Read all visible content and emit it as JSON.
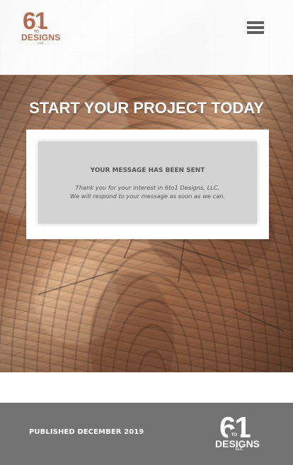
{
  "header": {
    "logo": {
      "number": "61",
      "to": "TO",
      "designs": "DESIGNS",
      "llc": "LLC"
    },
    "menu_icon": "hamburger-menu-icon"
  },
  "hero": {
    "title": "START YOUR PROJECT TODAY",
    "message": {
      "title": "YOUR MESSAGE HAS BEEN SENT",
      "line1": "Thank you for your interest in 6to1 Designs, LLC.",
      "line2": "We will respond to your message as soon as we can."
    }
  },
  "footer": {
    "published": "PUBLISHED DECEMBER 2019",
    "logo": {
      "number": "61",
      "to": "TO",
      "designs": "DESIGNS",
      "llc": "LLC"
    }
  },
  "colors": {
    "logo_brown": "#b06d51",
    "footer_gray": "#737373",
    "message_gray": "#d3d3d3",
    "text_gray": "#555555"
  }
}
